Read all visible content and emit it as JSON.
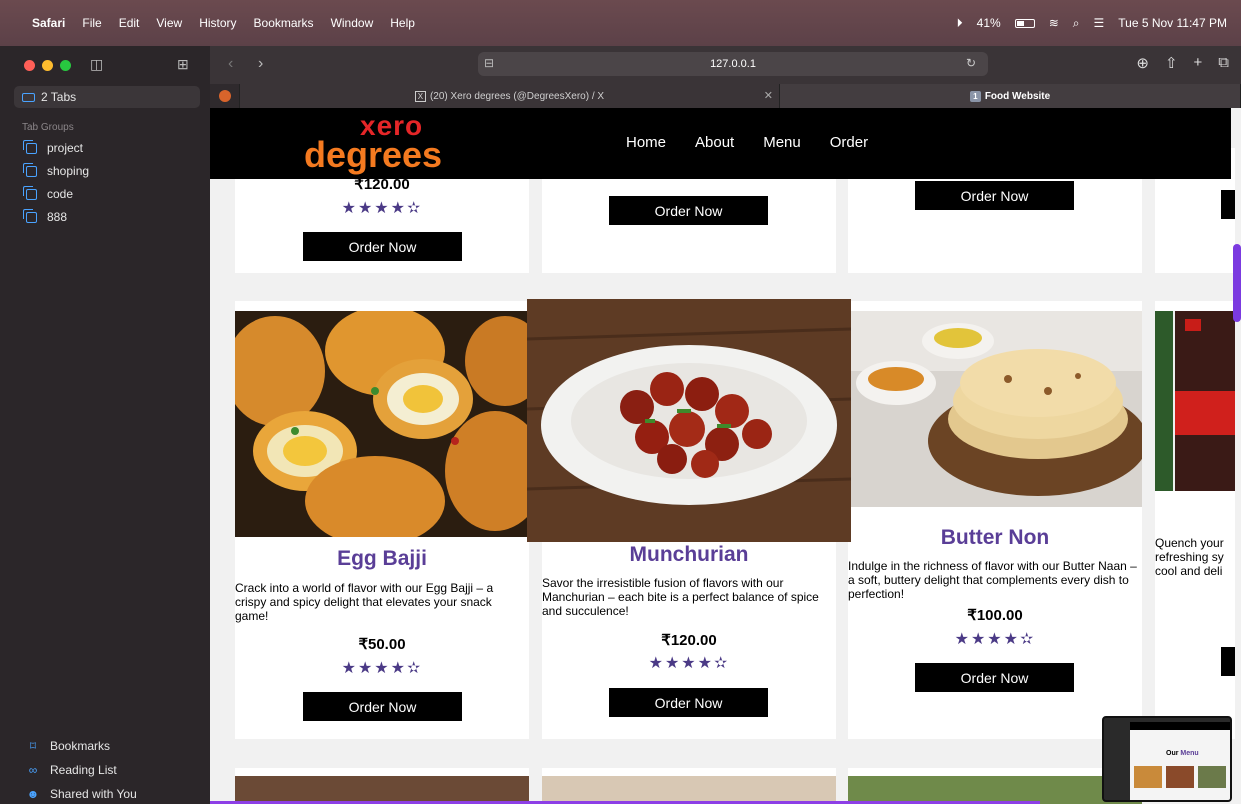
{
  "menubar": {
    "app": "Safari",
    "items": [
      "File",
      "Edit",
      "View",
      "History",
      "Bookmarks",
      "Window",
      "Help"
    ],
    "battery": "41%",
    "datetime": "Tue 5 Nov  11:47 PM"
  },
  "sidebar": {
    "tabs_label": "2 Tabs",
    "groups_heading": "Tab Groups",
    "groups": [
      "project",
      "shoping",
      "code",
      "888"
    ],
    "bottom": [
      "Bookmarks",
      "Reading List",
      "Shared with You"
    ]
  },
  "toolbar": {
    "url": "127.0.0.1"
  },
  "tabs": [
    {
      "label": "(20) Xero degrees (@DegreesXero) / X"
    },
    {
      "label": "Food Website",
      "badge": "1"
    }
  ],
  "site": {
    "logo_top": "xero",
    "logo_bottom": "degrees",
    "nav": [
      "Home",
      "About",
      "Menu",
      "Order"
    ]
  },
  "top_cards": [
    {
      "price": "₹120.00",
      "stars": "★★★★✫",
      "button": "Order Now"
    },
    {
      "button": "Order Now"
    },
    {
      "button": "Order Now"
    }
  ],
  "cards": [
    {
      "title": "Egg Bajji",
      "description": "Crack into a world of flavor with our Egg Bajji – a crispy and spicy delight that elevates your snack game!",
      "price": "₹50.00",
      "stars": "★★★★✫",
      "button": "Order Now"
    },
    {
      "title": "Munchurian",
      "description": "Savor the irresistible fusion of flavors with our Manchurian – each bite is a perfect balance of spice and succulence!",
      "price": "₹120.00",
      "stars": "★★★★✫",
      "button": "Order Now"
    },
    {
      "title": "Butter Non",
      "description": "Indulge in the richness of flavor with our Butter Naan – a soft, buttery delight that complements every dish to perfection!",
      "price": "₹100.00",
      "stars": "★★★★✫",
      "button": "Order Now"
    },
    {
      "description": "Quench your refreshing sy cool and deli"
    }
  ],
  "pip": {
    "heading_a": "Our",
    "heading_b": "Menu"
  },
  "colors": {
    "accent": "#5a3e97",
    "star": "#4b3a86",
    "logo_red": "#e52628",
    "logo_orange": "#f47a20"
  }
}
